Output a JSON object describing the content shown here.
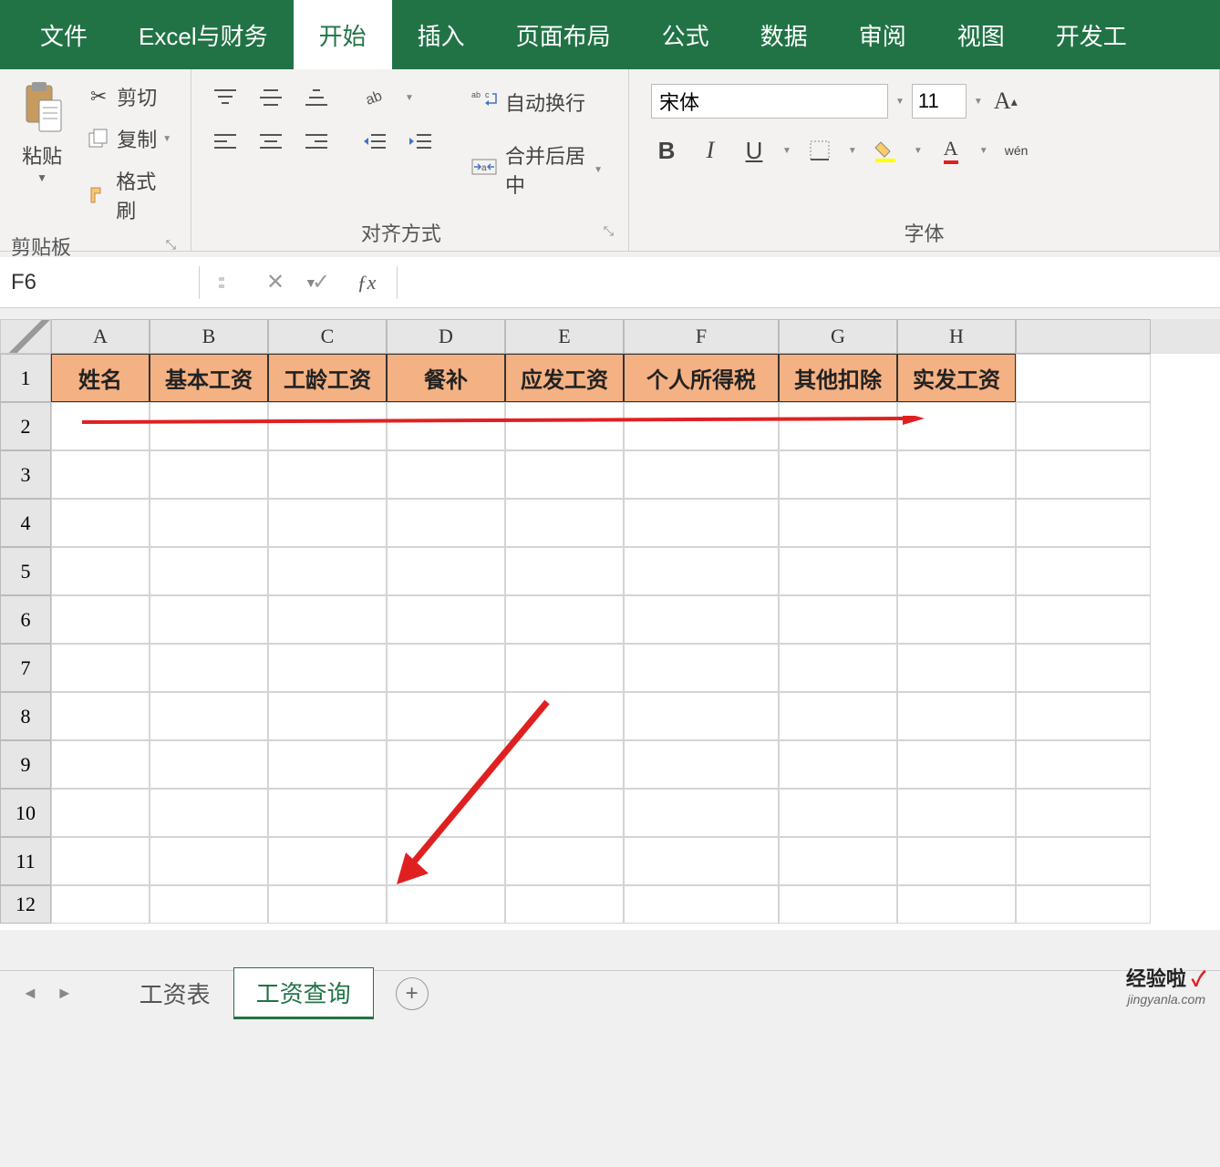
{
  "ribbon": {
    "tabs": [
      "文件",
      "Excel与财务",
      "开始",
      "插入",
      "页面布局",
      "公式",
      "数据",
      "审阅",
      "视图",
      "开发工"
    ],
    "active_tab_index": 2,
    "clipboard": {
      "paste": "粘贴",
      "cut": "剪切",
      "copy": "复制",
      "format_painter": "格式刷",
      "group_label": "剪贴板"
    },
    "alignment": {
      "wrap_text": "自动换行",
      "merge_center": "合并后居中",
      "group_label": "对齐方式"
    },
    "font": {
      "name": "宋体",
      "size": "11",
      "group_label": "字体",
      "bold": "B",
      "italic": "I",
      "underline": "U",
      "wen": "wén"
    }
  },
  "formula_bar": {
    "name_box": "F6",
    "formula": ""
  },
  "grid": {
    "columns": [
      "A",
      "B",
      "C",
      "D",
      "E",
      "F",
      "G",
      "H"
    ],
    "row_numbers": [
      "1",
      "2",
      "3",
      "4",
      "5",
      "6",
      "7",
      "8",
      "9",
      "10",
      "11",
      "12"
    ],
    "headers": [
      "姓名",
      "基本工资",
      "工龄工资",
      "餐补",
      "应发工资",
      "个人所得税",
      "其他扣除",
      "实发工资"
    ]
  },
  "sheet_tabs": {
    "tabs": [
      "工资表",
      "工资查询"
    ],
    "active_index": 1
  },
  "watermark": {
    "brand": "经验啦",
    "check": "✓",
    "url": "jingyanla.com"
  },
  "colors": {
    "excel_green": "#217346",
    "header_fill": "#f4b183"
  }
}
